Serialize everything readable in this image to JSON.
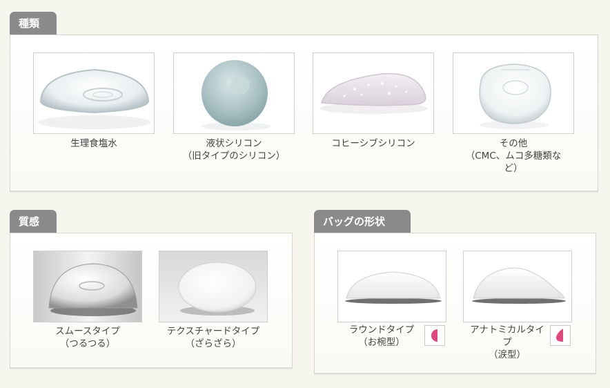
{
  "sections": {
    "types": {
      "title": "種類",
      "items": [
        {
          "caption_line1": "生理食塩水",
          "caption_line2": ""
        },
        {
          "caption_line1": "液状シリコン",
          "caption_line2": "（旧タイプのシリコン）"
        },
        {
          "caption_line1": "コヒーシブシリコン",
          "caption_line2": ""
        },
        {
          "caption_line1": "その他",
          "caption_line2": "（CMC、ムコ多糖類な",
          "caption_line3": "ど）"
        }
      ]
    },
    "texture": {
      "title": "質感",
      "items": [
        {
          "caption_line1": "スムースタイプ",
          "caption_line2": "（つるつる）"
        },
        {
          "caption_line1": "テクスチャードタイプ",
          "caption_line2": "（ざらざら）"
        }
      ]
    },
    "shape": {
      "title": "バッグの形状",
      "items": [
        {
          "caption_line1": "ラウンドタイプ",
          "caption_line2": "（お椀型）"
        },
        {
          "caption_line1": "アナトミカルタイ",
          "caption_line2": "プ",
          "caption_line3": "（涙型）"
        }
      ],
      "accent_color": "#e0457b"
    }
  }
}
